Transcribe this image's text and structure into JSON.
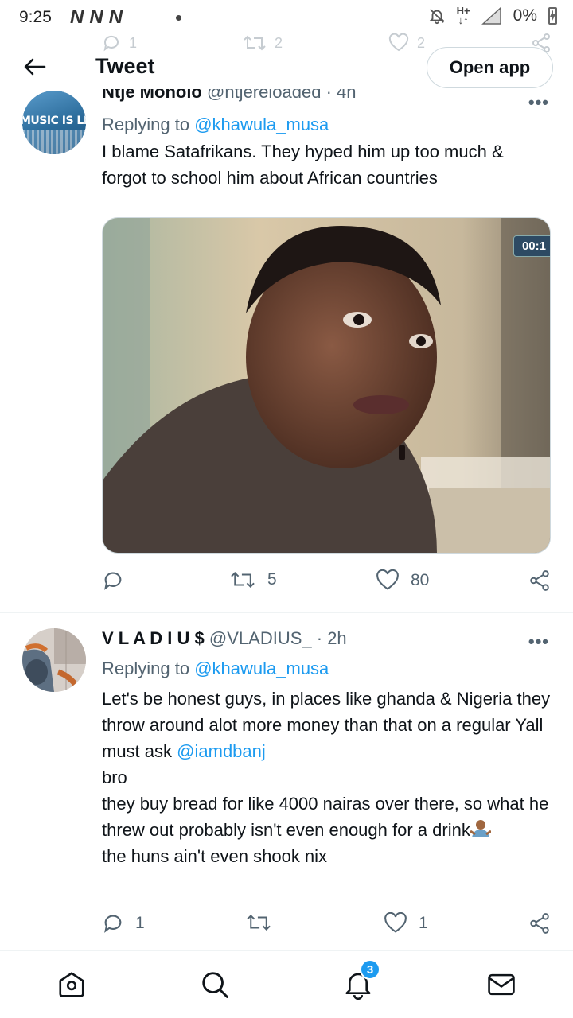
{
  "status_bar": {
    "time": "9:25",
    "left_icons": [
      "N",
      "N",
      "N"
    ],
    "network_label": "H+",
    "battery_percent": "0%"
  },
  "ghost_row": {
    "reply_count": "1",
    "retweet_count": "2",
    "like_count": "2"
  },
  "header": {
    "title": "Tweet",
    "open_app_label": "Open app"
  },
  "tweets": [
    {
      "avatar_text": "MUSIC IS LIF",
      "name": "Ntje Moholo",
      "handle": "@ntjereloaded",
      "time": "· 4h",
      "replying_prefix": "Replying to",
      "replying_handle": "@khawula_musa",
      "text": "I blame Satafrikans. They hyped him up too much & forgot to school him about African countries",
      "video_timer": "00:1",
      "retweets": "5",
      "likes": "80"
    },
    {
      "name": "V L A D I U $",
      "handle": "@VLADIUS_",
      "time": "· 2h",
      "replying_prefix": "Replying to",
      "replying_handle": "@khawula_musa",
      "text_part1": "Let's be honest guys, in places like ghanda & Nigeria they throw around alot more money than that on a regular Yall must ask",
      "mention": "@iamdbanj",
      "text_part2": "bro",
      "text_part3": "they buy bread for like 4000 nairas over there, so what he threw out  probably isn't even enough for a drink",
      "text_part4": "the huns ain't even shook nix",
      "replies": "1",
      "likes": "1"
    }
  ],
  "bottom_nav": {
    "notification_count": "3"
  },
  "colors": {
    "accent": "#1d9bf0",
    "text_primary": "#0f1419",
    "text_secondary": "#536471",
    "divider": "#eff3f4"
  }
}
